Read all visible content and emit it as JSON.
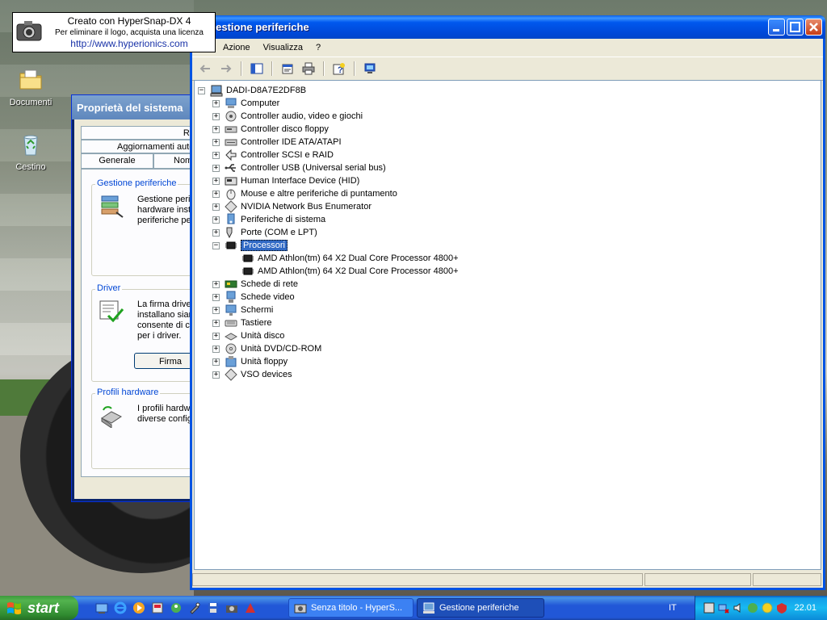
{
  "desktop": {
    "icons": [
      {
        "label": "Documenti"
      },
      {
        "label": "Cestino"
      }
    ]
  },
  "watermark": {
    "line1": "Creato con HyperSnap-DX 4",
    "line2": "Per eliminare il logo, acquista una licenza",
    "line3": "http://www.hyperionics.com"
  },
  "system_properties": {
    "title": "Proprietà del sistema",
    "tabs": [
      "Ripr",
      "Aggiornamenti auto",
      "Generale",
      "Nom"
    ],
    "groups": [
      {
        "title": "Gestione periferiche",
        "text": [
          "Gestione perif",
          "hardware insta",
          "periferiche pe"
        ]
      },
      {
        "title": "Driver",
        "text": [
          "La firma driver",
          "installano siam",
          "consente di co",
          "per i driver."
        ],
        "button": "Firma"
      },
      {
        "title": "Profili hardware",
        "text": [
          "I profili hardwa",
          "diverse config"
        ]
      }
    ]
  },
  "device_manager": {
    "title": "Gestione periferiche",
    "menu": [
      "Azione",
      "Visualizza",
      "?"
    ],
    "root": "DADI-D8A7E2DF8B",
    "nodes": [
      {
        "label": "Computer",
        "icon": "computer-icon",
        "expanded": false
      },
      {
        "label": "Controller audio, video e giochi",
        "icon": "audio-icon",
        "expanded": false
      },
      {
        "label": "Controller disco floppy",
        "icon": "floppy-controller-icon",
        "expanded": false
      },
      {
        "label": "Controller IDE ATA/ATAPI",
        "icon": "ide-controller-icon",
        "expanded": false
      },
      {
        "label": "Controller SCSI e RAID",
        "icon": "scsi-icon",
        "expanded": false
      },
      {
        "label": "Controller USB (Universal serial bus)",
        "icon": "usb-icon",
        "expanded": false
      },
      {
        "label": "Human Interface Device (HID)",
        "icon": "hid-icon",
        "expanded": false
      },
      {
        "label": "Mouse e altre periferiche di puntamento",
        "icon": "mouse-icon",
        "expanded": false
      },
      {
        "label": "NVIDIA Network Bus Enumerator",
        "icon": "network-bus-icon",
        "expanded": false
      },
      {
        "label": "Periferiche di sistema",
        "icon": "system-devices-icon",
        "expanded": false
      },
      {
        "label": "Porte (COM e LPT)",
        "icon": "ports-icon",
        "expanded": false
      },
      {
        "label": "Processori",
        "icon": "processor-icon",
        "expanded": true,
        "selected": true,
        "children": [
          {
            "label": "AMD Athlon(tm) 64 X2 Dual Core Processor 4800+"
          },
          {
            "label": "AMD Athlon(tm) 64 X2 Dual Core Processor 4800+"
          }
        ]
      },
      {
        "label": "Schede di rete",
        "icon": "network-card-icon",
        "expanded": false
      },
      {
        "label": "Schede video",
        "icon": "video-card-icon",
        "expanded": false
      },
      {
        "label": "Schermi",
        "icon": "monitor-icon",
        "expanded": false
      },
      {
        "label": "Tastiere",
        "icon": "keyboard-icon",
        "expanded": false
      },
      {
        "label": "Unità disco",
        "icon": "disk-drive-icon",
        "expanded": false
      },
      {
        "label": "Unità DVD/CD-ROM",
        "icon": "dvd-icon",
        "expanded": false
      },
      {
        "label": "Unità floppy",
        "icon": "floppy-drive-icon",
        "expanded": false
      },
      {
        "label": "VSO devices",
        "icon": "vso-icon",
        "expanded": false
      }
    ]
  },
  "taskbar": {
    "start_label": "start",
    "tasks": [
      {
        "label": "Senza titolo - HyperS...",
        "active": false
      },
      {
        "label": "Gestione periferiche",
        "active": true
      }
    ],
    "language": "IT",
    "clock": "22.01"
  },
  "colors": {
    "title_blue": "#0054e3",
    "selection": "#316ac5",
    "start_green": "#3c9a3c",
    "window_face": "#ece9d8"
  }
}
